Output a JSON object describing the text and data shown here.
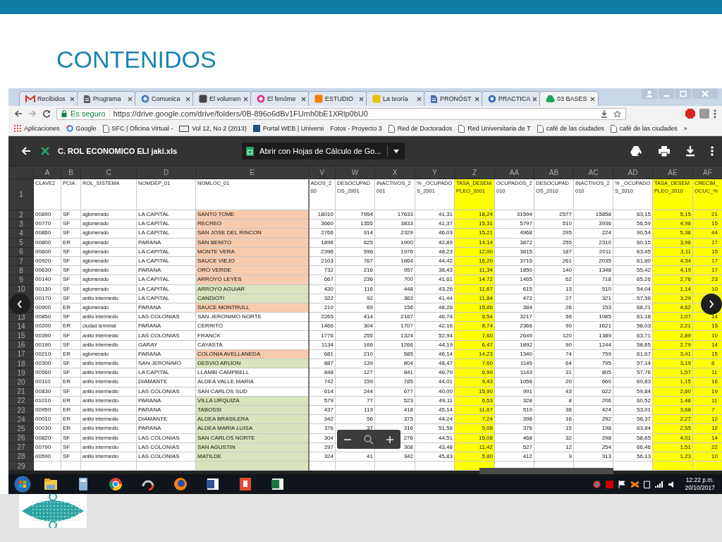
{
  "slide": {
    "title": "CONTENIDOS"
  },
  "browser": {
    "tabs": [
      {
        "label": "Recibidos",
        "kind": "mail",
        "color": "#d93025",
        "selected": false
      },
      {
        "label": "Programa",
        "kind": "page",
        "color": "#5f6368",
        "selected": false
      },
      {
        "label": "Comunica",
        "kind": "round",
        "color": "#4a7fc0",
        "selected": false
      },
      {
        "label": "El volumen",
        "kind": "square",
        "color": "#444444",
        "selected": false
      },
      {
        "label": "El fenóme",
        "kind": "round",
        "color": "#d83a8f",
        "selected": false
      },
      {
        "label": "ESTUDIO",
        "kind": "square",
        "color": "#f57d00",
        "selected": false
      },
      {
        "label": "La teoría",
        "kind": "square",
        "color": "#e8c400",
        "selected": false
      },
      {
        "label": "PRONÓST",
        "kind": "page",
        "color": "#4a6fb5",
        "selected": false
      },
      {
        "label": "PRACTICA",
        "kind": "round",
        "color": "#2a6cc0",
        "selected": false
      },
      {
        "label": "03 BASES",
        "kind": "drive",
        "color": "#1fa463",
        "selected": true
      }
    ],
    "address": {
      "security": "Es seguro",
      "url": "https://drive.google.com/drive/folders/0B-896o6dBv1FUmh0bE1XRlp0bU0"
    },
    "bookmarks": [
      {
        "label": "Aplicaciones",
        "kind": "apps"
      },
      {
        "label": "Google",
        "kind": "google"
      },
      {
        "label": "SFC | Oficina Virtual -",
        "kind": "page"
      },
      {
        "label": "Vol 12, No 2 (2013)",
        "kind": "pkp"
      },
      {
        "label": "Portal WEB | Universi",
        "kind": "portal"
      },
      {
        "label": "Fotos - Proyecto 3",
        "kind": "plain"
      },
      {
        "label": "Red de Doctorados",
        "kind": "page"
      },
      {
        "label": "Red Universitaria de T",
        "kind": "page"
      },
      {
        "label": "café de las ciudades",
        "kind": "page"
      },
      {
        "label": "café de las ciudades",
        "kind": "page"
      },
      {
        "label": "»",
        "kind": "plain"
      }
    ]
  },
  "viewer": {
    "file_name": "C. ROL ECONOMICO ELI jaki.xls",
    "open_with": "Abrir con Hojas de Cálculo de Go..."
  },
  "sheet": {
    "header_row": "1",
    "columns": [
      {
        "letter": "A",
        "name": "CLAVE2",
        "highlighted": false
      },
      {
        "letter": "B",
        "name": "PCIA",
        "highlighted": false
      },
      {
        "letter": "C",
        "name": "ROL_SISTEMA",
        "highlighted": false
      },
      {
        "letter": "D",
        "name": "NOMDEP_01",
        "highlighted": false
      },
      {
        "letter": "E",
        "name": "NOMLOC_01",
        "highlighted": false
      },
      {
        "letter": "V",
        "name": "ADOS_200",
        "highlighted": false
      },
      {
        "letter": "W",
        "name": "DESOCUPADOS_2001",
        "highlighted": false
      },
      {
        "letter": "X",
        "name": "INACTIVOS_2001",
        "highlighted": false
      },
      {
        "letter": "Y",
        "name": "% _OCUPADOS_2001",
        "highlighted": false
      },
      {
        "letter": "Z",
        "name": "TASA_DESEMPLEO_2001",
        "highlighted": true
      },
      {
        "letter": "AA",
        "name": "OCUPADOS_2010",
        "highlighted": false
      },
      {
        "letter": "AB",
        "name": "DESOCUPADOS_2010",
        "highlighted": false
      },
      {
        "letter": "AC",
        "name": "INACTIVOS_2010",
        "highlighted": false
      },
      {
        "letter": "AD",
        "name": "% _OCUPADOS_2010",
        "highlighted": false
      },
      {
        "letter": "AE",
        "name": "TASA_DESEMPLEO_2010",
        "highlighted": true
      },
      {
        "letter": "AF",
        "name": "CRECIM_OCUC_%",
        "highlighted": true
      }
    ],
    "rows": [
      {
        "row": "2",
        "color": "#f8cbad",
        "cells": [
          "00890",
          "SF",
          "aglomerado",
          "LA CAPITAL",
          "SANTO TOME",
          "18010",
          "7954",
          "17633",
          "41,31",
          "18,24",
          "31594",
          "2577",
          "15858",
          "63,15",
          "5,15",
          "21"
        ]
      },
      {
        "row": "3",
        "color": "#f8cbad",
        "cells": [
          "00770",
          "SF",
          "aglomerado",
          "LA CAPITAL",
          "RECREO",
          "3660",
          "1355",
          "3833",
          "41,37",
          "15,31",
          "5797",
          "510",
          "3936",
          "56,59",
          "4,98",
          "15"
        ]
      },
      {
        "row": "4",
        "color": "#f8cbad",
        "cells": [
          "00860",
          "SF",
          "aglomerado",
          "LA CAPITAL",
          "SAN JOSE DEL RINCON",
          "2766",
          "914",
          "2329",
          "46,03",
          "15,21",
          "4968",
          "295",
          "224",
          "90,54",
          "5,38",
          "44"
        ]
      },
      {
        "row": "5",
        "color": "#f8cbad",
        "cells": [
          "00800",
          "ER",
          "aglomerado",
          "PARANA",
          "SAN BENITO",
          "1896",
          "625",
          "1900",
          "42,89",
          "14,14",
          "3872",
          "255",
          "2310",
          "60,15",
          "3,96",
          "17"
        ]
      },
      {
        "row": "6",
        "color": "#f8cbad",
        "cells": [
          "00600",
          "SF",
          "aglomerado",
          "LA CAPITAL",
          "MONTE VERA",
          "2396",
          "596",
          "1976",
          "48,23",
          "12,00",
          "3815",
          "187",
          "2011",
          "63,45",
          "3,11",
          "15"
        ]
      },
      {
        "row": "7",
        "color": "#f8cbad",
        "cells": [
          "00920",
          "SF",
          "aglomerado",
          "LA CAPITAL",
          "SAUCE VIEJO",
          "2103",
          "767",
          "1864",
          "44,42",
          "16,20",
          "3715",
          "261",
          "2035",
          "61,80",
          "4,34",
          "17"
        ]
      },
      {
        "row": "8",
        "color": "#f8cbad",
        "cells": [
          "00630",
          "SF",
          "aglomerado",
          "PARANA",
          "ORO VERDE",
          "732",
          "216",
          "957",
          "38,43",
          "11,34",
          "1850",
          "140",
          "1348",
          "55,42",
          "4,19",
          "17"
        ]
      },
      {
        "row": "9",
        "color": "#f8cbad",
        "cells": [
          "00140",
          "SF",
          "aglomerado",
          "LA CAPITAL",
          "ARROYO LEYES",
          "667",
          "236",
          "700",
          "41,61",
          "14,72",
          "1465",
          "62",
          "718",
          "65,26",
          "2,76",
          "23"
        ]
      },
      {
        "row": "10",
        "color": "#d8e4bc",
        "cells": [
          "00130",
          "SF",
          "aglomerado",
          "LA CAPITAL",
          "ARROYO AGUIAR",
          "430",
          "116",
          "448",
          "43,26",
          "11,67",
          "615",
          "13",
          "510",
          "54,04",
          "1,14",
          "10"
        ]
      },
      {
        "color": "#d8e4bc",
        "cells": [
          "00170",
          "SF",
          "anillo intermedio",
          "LA CAPITAL",
          "CANDIOTI",
          "322",
          "92",
          "363",
          "41,44",
          "11,84",
          "472",
          "27",
          "321",
          "57,56",
          "3,29",
          null
        ]
      },
      {
        "color": "#f8cbad",
        "cells": [
          "00900",
          "ER",
          "aglomerado",
          "PARANA",
          "SAUCE MONTRULL",
          "210",
          "69",
          "156",
          "48,28",
          "15,86",
          "384",
          "26",
          "153",
          "68,21",
          "4,62",
          null
        ]
      },
      {
        "row": "13",
        "cells": [
          "00850",
          "SF",
          "anillo intermedio",
          "LAS COLONIAS",
          "SAN JERONIMO NORTE",
          "2265",
          "414",
          "2167",
          "46,74",
          "8,54",
          "3217",
          "56",
          "1985",
          "61,18",
          "1,07",
          "14"
        ]
      },
      {
        "row": "14",
        "cells": [
          "00200",
          "ER",
          "ciudad terminal",
          "PARANA",
          "CERRITO",
          "1466",
          "304",
          "1707",
          "42,16",
          "8,74",
          "2366",
          "90",
          "1621",
          "58,03",
          "2,21",
          "15"
        ]
      },
      {
        "row": "15",
        "cells": [
          "00390",
          "SF",
          "anillo intermedio",
          "LAS COLONIAS",
          "FRANCK",
          "1776",
          "255",
          "1324",
          "52,94",
          "7,60",
          "2649",
          "120",
          "1389",
          "63,71",
          "2,89",
          "10"
        ]
      },
      {
        "row": "16",
        "cells": [
          "00190",
          "SF",
          "anillo intermedio",
          "GARAY",
          "CAYASTA",
          "1134",
          "166",
          "1266",
          "44,19",
          "6,47",
          "1892",
          "90",
          "1244",
          "58,65",
          "2,79",
          "14"
        ]
      },
      {
        "row": "17",
        "color": "#f8cbad",
        "cells": [
          "00210",
          "ER",
          "aglomerado",
          "PARANA",
          "COLONIA AVELLANEDA",
          "681",
          "210",
          "585",
          "46,14",
          "14,23",
          "1340",
          "74",
          "759",
          "61,67",
          "3,41",
          "15"
        ]
      },
      {
        "row": "18",
        "color": "#d8e4bc",
        "cells": [
          "00300",
          "SF",
          "anillo intermedio",
          "SAN JERONIMO",
          "DESVIO ARIJON",
          "887",
          "139",
          "804",
          "48,47",
          "7,60",
          "1145",
          "64",
          "795",
          "57,14",
          "3,19",
          "8"
        ]
      },
      {
        "row": "19",
        "cells": [
          "00560",
          "SF",
          "anillo intermedio",
          "LA CAPITAL",
          "LLAMBI CAMPBELL",
          "848",
          "127",
          "841",
          "46,70",
          "6,99",
          "1143",
          "31",
          "805",
          "57,76",
          "1,57",
          "11"
        ]
      },
      {
        "row": "20",
        "cells": [
          "00110",
          "ER",
          "anillo intermedio",
          "DIAMANTE",
          "ALDEA VALLE MARIA",
          "742",
          "159",
          "785",
          "44,01",
          "9,43",
          "1056",
          "20",
          "660",
          "60,83",
          "1,15",
          "16"
        ]
      },
      {
        "row": "21",
        "cells": [
          "00830",
          "SF",
          "anillo intermedio",
          "LAS COLONIAS",
          "SAN CARLOS SUD",
          "614",
          "244",
          "677",
          "40,00",
          "15,90",
          "991",
          "43",
          "622",
          "59,84",
          "2,60",
          "19"
        ]
      },
      {
        "row": "22",
        "color": "#d8e4bc",
        "cells": [
          "01010",
          "ER",
          "anillo intermedio",
          "PARANA",
          "VILLA URQUIZA",
          "579",
          "77",
          "523",
          "49,11",
          "6,53",
          "328",
          "8",
          "206",
          "60,52",
          "1,48",
          "11"
        ]
      },
      {
        "row": "23",
        "color": "#d8e4bc",
        "cells": [
          "00950",
          "ER",
          "anillo intermedio",
          "PARANA",
          "TABOSSI",
          "437",
          "113",
          "418",
          "45,14",
          "11,67",
          "519",
          "36",
          "424",
          "53,01",
          "3,68",
          "7"
        ]
      },
      {
        "row": "24",
        "color": "#d8e4bc",
        "cells": [
          "00010",
          "ER",
          "anillo intermedio",
          "DIAMANTE",
          "ALDEA BRASILERA",
          "342",
          "56",
          "375",
          "44,24",
          "7,24",
          "398",
          "16",
          "292",
          "56,37",
          "2,27",
          "12"
        ]
      },
      {
        "row": "25",
        "color": "#d8e4bc",
        "cells": [
          "00030",
          "ER",
          "anillo intermedio",
          "PARANA",
          "ALDEA MARIA LUISA",
          "376",
          "37",
          "316",
          "51,58",
          "5,08",
          "376",
          "15",
          "198",
          "63,84",
          "2,55",
          "12"
        ]
      },
      {
        "row": "26",
        "color": "#d8e4bc",
        "cells": [
          "00820",
          "SF",
          "anillo intermedio",
          "LAS COLONIAS",
          "SAN CARLOS NORTE",
          "304",
          null,
          "276",
          "44,51",
          "15,08",
          "468",
          "32",
          "298",
          "58,65",
          "4,01",
          "14"
        ]
      },
      {
        "row": "27",
        "color": "#d8e4bc",
        "cells": [
          "00790",
          "SF",
          "anillo intermedio",
          "LAS COLONIAS",
          "SAN AGUSTIN",
          "297",
          null,
          "308",
          "43,48",
          "11,42",
          "527",
          "12",
          "254",
          "66,46",
          "1,51",
          "22"
        ]
      },
      {
        "row": "28",
        "color": "#d8e4bc",
        "cells": [
          "00590",
          "SF",
          "anillo intermedio",
          "LAS COLONIAS",
          "MATILDE",
          "324",
          "41",
          "342",
          "45,83",
          "5,80",
          "412",
          "9",
          "313",
          "56,13",
          "1,23",
          "10"
        ]
      },
      {
        "row": "29",
        "color": "#d8e4bc"
      }
    ]
  },
  "taskbar": {
    "time": "12:22 p.m.",
    "date": "20/10/2017"
  }
}
